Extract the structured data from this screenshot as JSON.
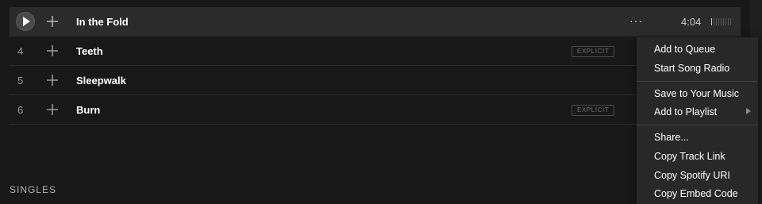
{
  "tracks": [
    {
      "number": "",
      "title": "In the Fold",
      "explicit": "",
      "duration": "4:04",
      "more": "···",
      "popularity": 0.15
    },
    {
      "number": "4",
      "title": "Teeth",
      "explicit": "EXPLICIT"
    },
    {
      "number": "5",
      "title": "Sleepwalk",
      "explicit": ""
    },
    {
      "number": "6",
      "title": "Burn",
      "explicit": "EXPLICIT"
    }
  ],
  "section": {
    "title": "SINGLES"
  },
  "context_menu": {
    "items": [
      "Add to Queue",
      "Start Song Radio",
      "Save to Your Music",
      "Add to Playlist",
      "Share...",
      "Copy Track Link",
      "Copy Spotify URI",
      "Copy Embed Code"
    ]
  },
  "colors": {
    "background": "#181818",
    "row_active": "#2b2b2b",
    "menu_background": "#282828",
    "text_primary": "#ffffff",
    "text_muted": "#9b9b9b"
  }
}
